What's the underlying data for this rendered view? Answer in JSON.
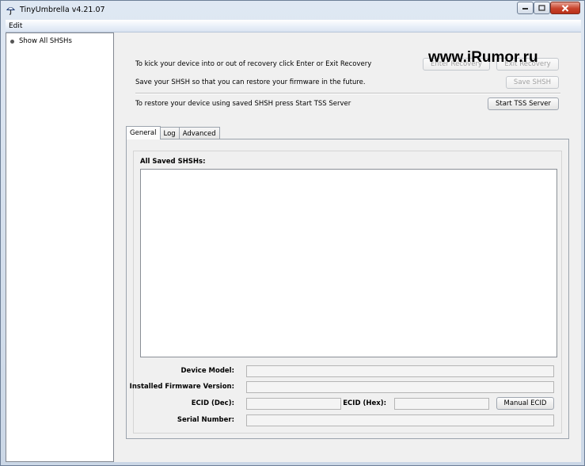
{
  "window": {
    "title": "TinyUmbrella v4.21.07"
  },
  "menu": {
    "edit": "Edit"
  },
  "sidebar": {
    "items": [
      {
        "label": "Show All SHSHs"
      }
    ]
  },
  "watermark": "www.iRumor.ru",
  "controls": {
    "recovery_text": "To kick your device into or out of recovery click Enter or Exit Recovery",
    "enter_recovery": "Enter Recovery",
    "exit_recovery": "Exit Recovery",
    "save_text": "Save your SHSH so that you can restore your firmware in the future.",
    "save_shsh": "Save SHSH",
    "tss_text": "To restore your device using saved SHSH press Start TSS Server",
    "start_tss": "Start TSS Server"
  },
  "tabs": [
    {
      "label": "General"
    },
    {
      "label": "Log"
    },
    {
      "label": "Advanced"
    }
  ],
  "general": {
    "saved_shsh_label": "All Saved SHSHs:",
    "device_model_label": "Device Model:",
    "device_model_value": "",
    "firmware_label": "Installed Firmware Version:",
    "firmware_value": "",
    "ecid_dec_label": "ECID (Dec):",
    "ecid_dec_value": "",
    "ecid_hex_label": "ECID (Hex):",
    "ecid_hex_value": "",
    "manual_ecid": "Manual ECID",
    "serial_label": "Serial Number:",
    "serial_value": ""
  },
  "colors": {
    "titlebar": "#dfe8f3",
    "close_button": "#c8432c",
    "panel": "#f0f0f0"
  }
}
